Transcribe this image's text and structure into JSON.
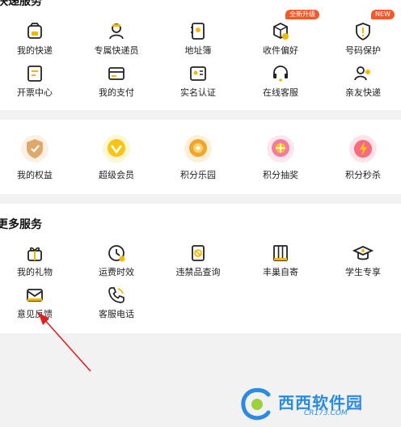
{
  "sections": {
    "express": {
      "title": "快递服务",
      "items": [
        {
          "label": "我的快递",
          "icon": "package-icon"
        },
        {
          "label": "专属快递员",
          "icon": "courier-icon"
        },
        {
          "label": "地址簿",
          "icon": "address-book-icon"
        },
        {
          "label": "收件偏好",
          "icon": "parcel-preference-icon",
          "badge": "全新升级"
        },
        {
          "label": "号码保护",
          "icon": "shield-icon",
          "badge": "NEW"
        },
        {
          "label": "开票中心",
          "icon": "invoice-icon"
        },
        {
          "label": "我的支付",
          "icon": "card-icon"
        },
        {
          "label": "实名认证",
          "icon": "id-card-icon"
        },
        {
          "label": "在线客服",
          "icon": "headset-icon"
        },
        {
          "label": "亲友快递",
          "icon": "friends-icon"
        }
      ]
    },
    "rewards": {
      "items": [
        {
          "label": "我的权益",
          "icon": "benefit-medal-icon"
        },
        {
          "label": "超级会员",
          "icon": "super-member-icon"
        },
        {
          "label": "积分乐园",
          "icon": "points-park-icon"
        },
        {
          "label": "积分抽奖",
          "icon": "points-lottery-icon"
        },
        {
          "label": "积分秒杀",
          "icon": "points-flash-sale-icon"
        }
      ]
    },
    "more": {
      "title": "更多服务",
      "items": [
        {
          "label": "我的礼物",
          "icon": "gift-icon"
        },
        {
          "label": "运费时效",
          "icon": "clock-icon"
        },
        {
          "label": "违禁品查询",
          "icon": "prohibited-items-icon"
        },
        {
          "label": "丰巢自寄",
          "icon": "locker-icon"
        },
        {
          "label": "学生专享",
          "icon": "graduation-cap-icon"
        },
        {
          "label": "意见反馈",
          "icon": "feedback-mail-icon"
        },
        {
          "label": "客服电话",
          "icon": "phone-icon"
        }
      ]
    }
  },
  "annotation": {
    "type": "red-arrow",
    "target": "意见反馈"
  },
  "watermark": {
    "brand": "西西软件园",
    "url": "CR173.COM"
  },
  "colors": {
    "accent": "#f5b800",
    "badge": "#f15a2b",
    "arrow": "#e02020",
    "watermark": "#2b8be0"
  }
}
